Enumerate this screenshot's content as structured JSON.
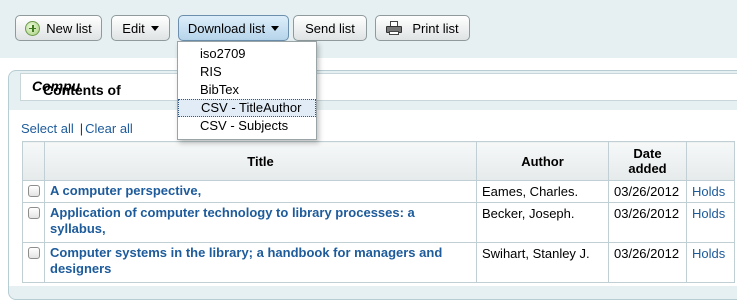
{
  "toolbar": {
    "new_list": "New list",
    "edit": "Edit",
    "download_list": "Download list",
    "send_list": "Send list",
    "print_list": "Print list"
  },
  "download_menu": {
    "items": [
      "iso2709",
      "RIS",
      "BibTex",
      "CSV - TitleAuthor",
      "CSV - Subjects"
    ],
    "highlighted": "CSV - TitleAuthor"
  },
  "heading": {
    "prefix": "Contents of ",
    "list_name": "Compu"
  },
  "selection": {
    "select_all": "Select all",
    "separator": "|",
    "clear_all": "Clear all"
  },
  "table": {
    "headers": {
      "title": "Title",
      "author": "Author",
      "date_added": "Date added"
    },
    "rows": [
      {
        "title": "A computer perspective,",
        "author": "Eames, Charles.",
        "date": "03/26/2012",
        "action": "Holds"
      },
      {
        "title": "Application of computer technology to library processes: a syllabus,",
        "author": "Becker, Joseph.",
        "date": "03/26/2012",
        "action": "Holds"
      },
      {
        "title": "Computer systems in the library; a handbook for managers and designers",
        "author": "Swihart, Stanley J.",
        "date": "03/26/2012",
        "action": "Holds"
      }
    ]
  },
  "colors": {
    "link": "#1d5b9b",
    "toolbar_bg": "#e6f0f2",
    "menu_highlight": "#e2ecf7"
  }
}
